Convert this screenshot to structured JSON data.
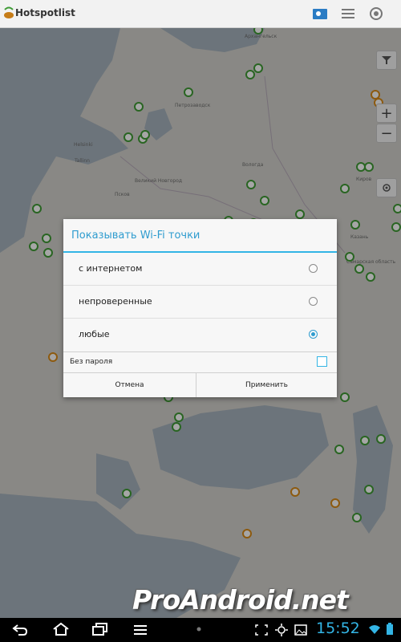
{
  "app": {
    "title": "Hotspotlist",
    "actions": {
      "map_icon": "map-pin-icon",
      "menu_icon": "hamburger-icon",
      "locate_icon": "target-icon"
    }
  },
  "map": {
    "labels": [
      "Архангельск",
      "Петрозаводск",
      "Helsinki",
      "Tallinn",
      "Великий Новгород",
      "Псков",
      "Вологда",
      "Киров",
      "Казань",
      "Самарская область"
    ],
    "controls": {
      "filter_icon": "filter-icon",
      "zoom_in": "+",
      "zoom_out": "−",
      "locate_icon": "crosshair-icon"
    }
  },
  "dialog": {
    "title": "Показывать Wi-Fi точки",
    "options": [
      {
        "label": "с интернетом",
        "selected": false
      },
      {
        "label": "непроверенные",
        "selected": false
      },
      {
        "label": "любые",
        "selected": true
      }
    ],
    "no_password_label": "Без пароля",
    "no_password_checked": false,
    "cancel_label": "Отмена",
    "apply_label": "Применить"
  },
  "watermark": "ProAndroid.net",
  "status": {
    "time": "15:52",
    "nav": {
      "back_icon": "back-icon",
      "home_icon": "home-icon",
      "recent_icon": "recent-apps-icon",
      "menu_icon": "menu-icon"
    }
  },
  "colors": {
    "accent": "#33b5e5",
    "pin_green": "#3f9b35",
    "pin_orange": "#d98a17"
  }
}
